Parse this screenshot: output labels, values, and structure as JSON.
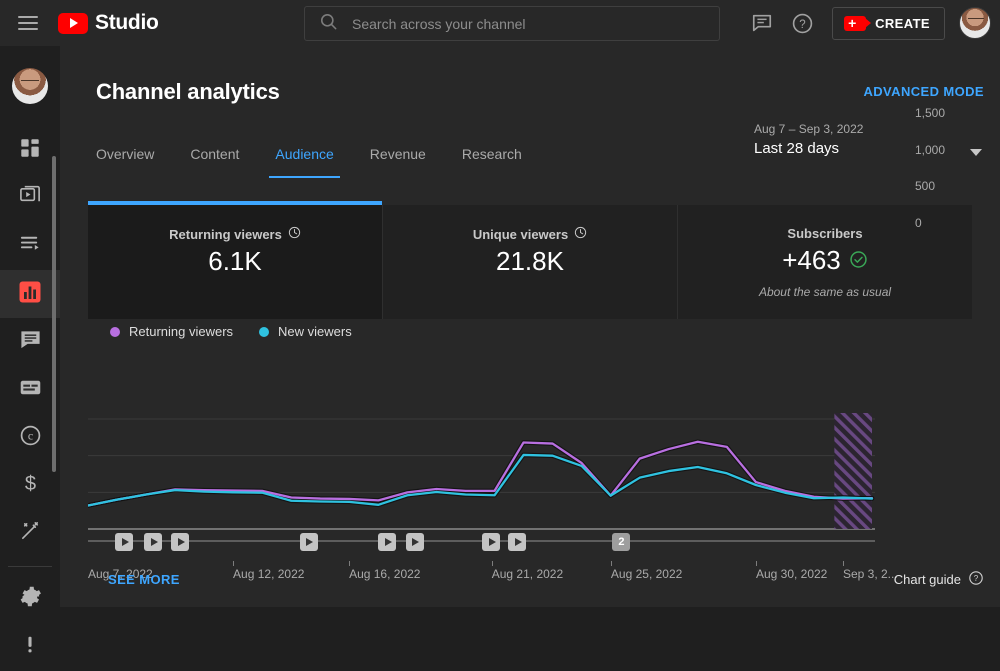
{
  "topbar": {
    "menu_icon": "hamburger-icon",
    "brand": "Studio",
    "search_placeholder": "Search across your channel",
    "search_value": "",
    "create_label": "CREATE",
    "feedback_icon": "comment-icon",
    "help_icon": "help-icon",
    "avatar": "account-avatar"
  },
  "sidebar": {
    "items": [
      {
        "name": "dashboard",
        "icon": "dashboard-icon"
      },
      {
        "name": "content",
        "icon": "video-library-icon"
      },
      {
        "name": "playlists",
        "icon": "playlist-icon"
      },
      {
        "name": "analytics",
        "icon": "analytics-bar-icon",
        "active": true
      },
      {
        "name": "comments",
        "icon": "comment-bubble-icon"
      },
      {
        "name": "subtitles",
        "icon": "subtitles-icon"
      },
      {
        "name": "copyright",
        "icon": "copyright-icon"
      },
      {
        "name": "earn",
        "icon": "dollar-icon"
      },
      {
        "name": "customization",
        "icon": "magic-wand-icon"
      },
      {
        "name": "settings",
        "icon": "gear-icon"
      },
      {
        "name": "send-feedback",
        "icon": "feedback-icon"
      }
    ]
  },
  "header": {
    "title": "Channel analytics",
    "advanced_mode": "ADVANCED MODE"
  },
  "tabs": [
    {
      "label": "Overview",
      "active": false
    },
    {
      "label": "Content",
      "active": false
    },
    {
      "label": "Audience",
      "active": true
    },
    {
      "label": "Revenue",
      "active": false
    },
    {
      "label": "Research",
      "active": false
    }
  ],
  "date_range": {
    "range": "Aug 7 – Sep 3, 2022",
    "preset": "Last 28 days",
    "caret": "chevron-down-icon"
  },
  "cards": [
    {
      "label": "Returning viewers",
      "value": "6.1K",
      "note": "",
      "info_icon": "clock-icon",
      "status_icon": "",
      "active": true
    },
    {
      "label": "Unique viewers",
      "value": "21.8K",
      "note": "",
      "info_icon": "clock-icon",
      "status_icon": "",
      "active": false
    },
    {
      "label": "Subscribers",
      "value": "+463",
      "note": "About the same as usual",
      "info_icon": "",
      "status_icon": "check-circle-icon",
      "active": false
    }
  ],
  "legend": [
    {
      "label": "Returning viewers",
      "color": "#b86fe0"
    },
    {
      "label": "New viewers",
      "color": "#2fc2e0"
    }
  ],
  "footer": {
    "see_more": "SEE MORE",
    "chart_guide": "Chart guide",
    "chart_guide_icon": "help-circle-icon"
  },
  "video_markers": [
    {
      "x_pct": 3.5,
      "label": "",
      "count": 1
    },
    {
      "x_pct": 7.2,
      "label": "",
      "count": 1
    },
    {
      "x_pct": 10.6,
      "label": "",
      "count": 1
    },
    {
      "x_pct": 27.0,
      "label": "",
      "count": 1
    },
    {
      "x_pct": 37.0,
      "label": "",
      "count": 1
    },
    {
      "x_pct": 40.5,
      "label": "",
      "count": 1
    },
    {
      "x_pct": 50.3,
      "label": "",
      "count": 1
    },
    {
      "x_pct": 53.6,
      "label": "",
      "count": 1
    },
    {
      "x_pct": 66.9,
      "label": "2",
      "count": 2
    }
  ],
  "chart_data": {
    "type": "line",
    "title": "",
    "xlabel": "",
    "ylabel": "",
    "ylim": [
      0,
      1600
    ],
    "yticks": [
      0,
      500,
      1000,
      1500
    ],
    "ytick_labels": [
      "0",
      "500",
      "1,000",
      "1,500"
    ],
    "grid": true,
    "legend_position": "top-left",
    "x": [
      "Aug 7, 2022",
      "Aug 8, 2022",
      "Aug 9, 2022",
      "Aug 10, 2022",
      "Aug 11, 2022",
      "Aug 12, 2022",
      "Aug 13, 2022",
      "Aug 14, 2022",
      "Aug 15, 2022",
      "Aug 16, 2022",
      "Aug 17, 2022",
      "Aug 18, 2022",
      "Aug 19, 2022",
      "Aug 20, 2022",
      "Aug 21, 2022",
      "Aug 22, 2022",
      "Aug 23, 2022",
      "Aug 24, 2022",
      "Aug 25, 2022",
      "Aug 26, 2022",
      "Aug 27, 2022",
      "Aug 28, 2022",
      "Aug 29, 2022",
      "Aug 30, 2022",
      "Aug 31, 2022",
      "Sep 1, 2022",
      "Sep 2, 2022",
      "Sep 3, 2022"
    ],
    "xtick_labels": [
      "Aug 7, 2022",
      "Aug 12, 2022",
      "Aug 16, 2022",
      "Aug 21, 2022",
      "Aug 25, 2022",
      "Aug 30, 2022",
      "Sep 3, 2..."
    ],
    "xtick_positions_pct": [
      0,
      18.5,
      33.3,
      51.5,
      66.7,
      85.2,
      96.3
    ],
    "partial_data_region": {
      "from_pct": 95.2,
      "to_pct": 100,
      "style": "hatched"
    },
    "series": [
      {
        "name": "Returning viewers",
        "color": "#b86fe0",
        "values": [
          320,
          400,
          470,
          540,
          530,
          525,
          520,
          430,
          415,
          410,
          390,
          500,
          545,
          520,
          520,
          1180,
          1165,
          900,
          455,
          960,
          1090,
          1190,
          1120,
          640,
          520,
          440,
          415,
          420
        ]
      },
      {
        "name": "New viewers",
        "color": "#2fc2e0",
        "values": [
          320,
          400,
          470,
          530,
          510,
          500,
          495,
          385,
          375,
          370,
          330,
          460,
          505,
          470,
          460,
          1010,
          1000,
          860,
          455,
          700,
          790,
          845,
          760,
          600,
          495,
          420,
          430,
          415
        ]
      }
    ]
  }
}
